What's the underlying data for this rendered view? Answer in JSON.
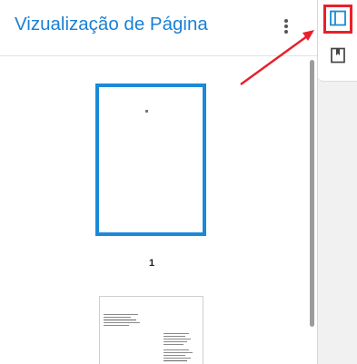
{
  "panel": {
    "title": "Vizualização de Página",
    "menu_icon": "more-vert-icon"
  },
  "thumbnails": {
    "pages": [
      {
        "number": "1",
        "selected": true
      },
      {
        "number": "",
        "selected": false
      }
    ]
  },
  "rail": {
    "buttons": [
      {
        "icon": "sidebar-panel-icon",
        "active": true
      },
      {
        "icon": "bookmark-icon",
        "active": false
      }
    ]
  },
  "colors": {
    "accent": "#1a80d6",
    "selection_border": "#1a8ad8",
    "highlight": "#e8202a"
  }
}
